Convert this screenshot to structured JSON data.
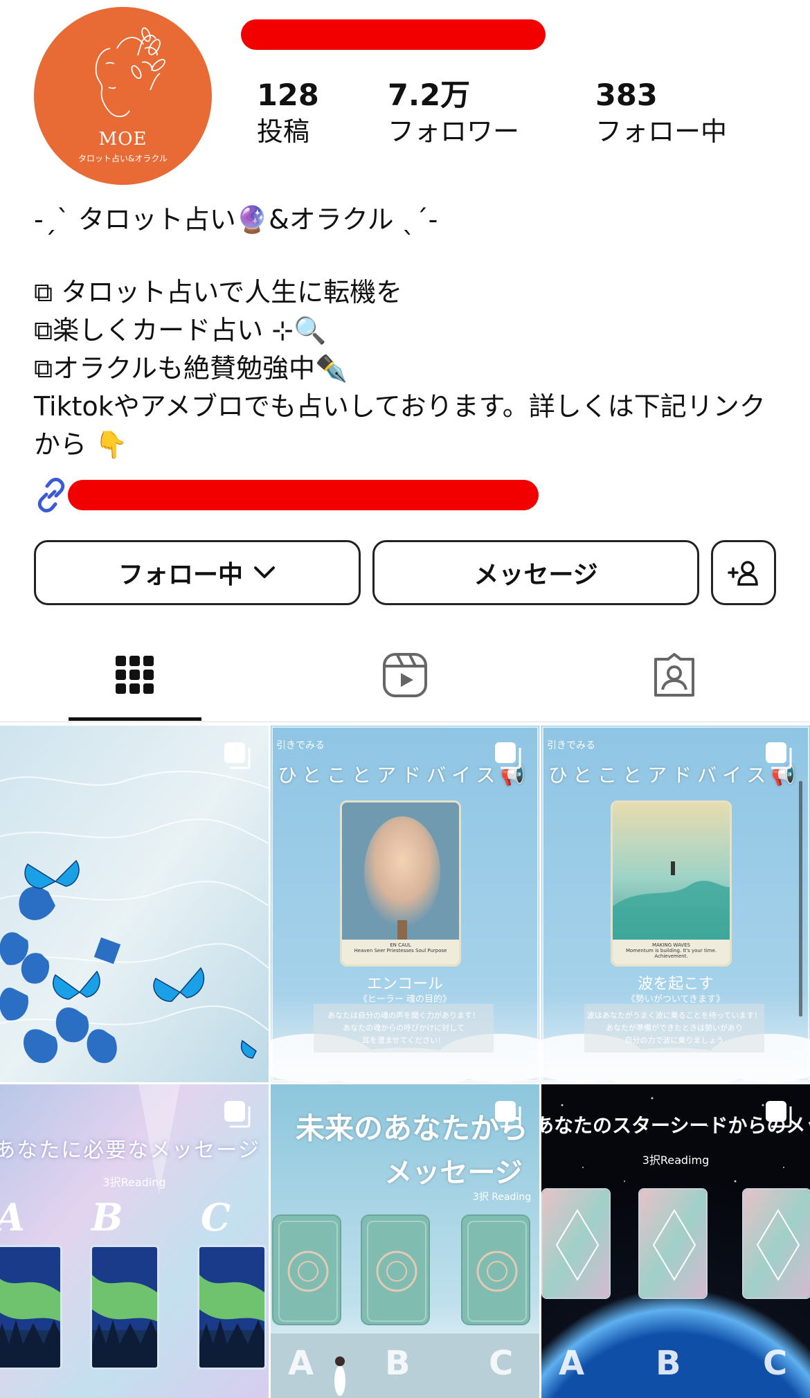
{
  "profile": {
    "avatar_name": "MOE",
    "avatar_subtitle": "タロット占い&オラクル",
    "brand_color": "#e86a34"
  },
  "stats": {
    "posts": {
      "count": "128",
      "label": "投稿"
    },
    "followers": {
      "count": "7.2万",
      "label": "フォロワー"
    },
    "following": {
      "count": "383",
      "label": "フォロー中"
    }
  },
  "bio": {
    "line1": "-ˏˋ タロット占い🔮&オラクル ˎˊ-",
    "line2": "⧉ タロット占いで人生に転機を",
    "line3": "⧉楽しくカード占い ⊹🔍",
    "line4": "⧉オラクルも絶賛勉強中✒️",
    "line5": "Tiktokやアメブロでも占いしております。詳しくは下記リンクから 👇"
  },
  "buttons": {
    "follow_label": "フォロー中",
    "message_label": "メッセージ"
  },
  "tabs": [
    {
      "name": "posts",
      "icon": "grid-icon",
      "active": true
    },
    {
      "name": "reels",
      "icon": "reels-icon",
      "active": false
    },
    {
      "name": "tagged",
      "icon": "tagged-icon",
      "active": false
    }
  ],
  "posts": {
    "p2": {
      "small": "引きでみる",
      "title": "ひとことアドバイス📢",
      "card_caption_1": "EN CAUL",
      "card_caption_2": "Heaven Seer Priestesses Soul Purpose",
      "card_name": "エンコール",
      "card_sub": "《ヒーラー 魂の目的》",
      "message_1": "あなたは自分の魂の声を聞く力があります！",
      "message_2": "あなたの魂からの呼びかけに対して",
      "message_3": "耳を澄ませてください！"
    },
    "p3": {
      "small": "引きでみる",
      "title": "ひとことアドバイス📢",
      "card_caption_1": "MAKING WAVES",
      "card_caption_2": "Momentum is building. It's your time. Achievement.",
      "card_name": "波を起こす",
      "card_sub": "《勢いがついてきます》",
      "message_1": "波はあなたがうまく波に乗ることを待っています！",
      "message_2": "あなたが準備ができたときは勢いがあり",
      "message_3": "自分の力で波に乗りましょう"
    },
    "p4": {
      "title": "あなたに必要なメッセージ",
      "subtitle": "3択Reading",
      "letters": [
        "A",
        "B",
        "C"
      ]
    },
    "p5": {
      "title_1": "未来のあなたから",
      "title_2": "メッセージ",
      "subtitle": "3択 Reading",
      "letters": [
        "A",
        "B",
        "C"
      ]
    },
    "p6": {
      "title": "あなたのスターシードからのメッセージ",
      "subtitle": "3択Readimg",
      "letters": [
        "A",
        "B",
        "C"
      ]
    }
  }
}
